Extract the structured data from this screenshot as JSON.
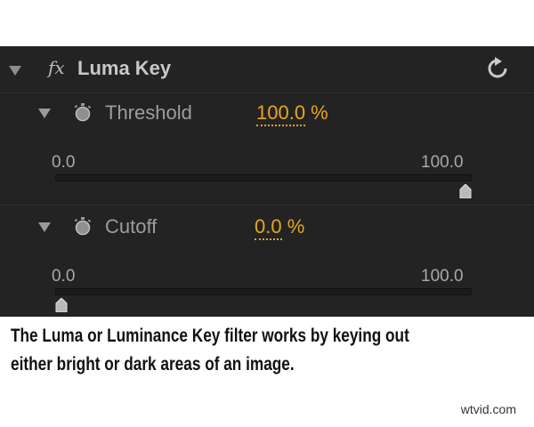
{
  "effect": {
    "fx_icon": "fx",
    "name": "Luma Key",
    "reset_icon": "reset-icon"
  },
  "params": [
    {
      "label": "Threshold",
      "value": "100.0",
      "unit": " %",
      "scale_min": "0.0",
      "scale_max": "100.0",
      "level": 1.0
    },
    {
      "label": "Cutoff",
      "value": "0.0",
      "unit": " %",
      "scale_min": "0.0",
      "scale_max": "100.0",
      "level": 0.0
    }
  ],
  "caption": {
    "line1": "The Luma or Luminance Key filter works by keying out",
    "line2": "either bright or dark areas of an image."
  },
  "watermark": "wtvid.com",
  "colors": {
    "panel_bg": "#232323",
    "value_accent": "#e8a623",
    "label_gray": "#9d9d9d"
  }
}
